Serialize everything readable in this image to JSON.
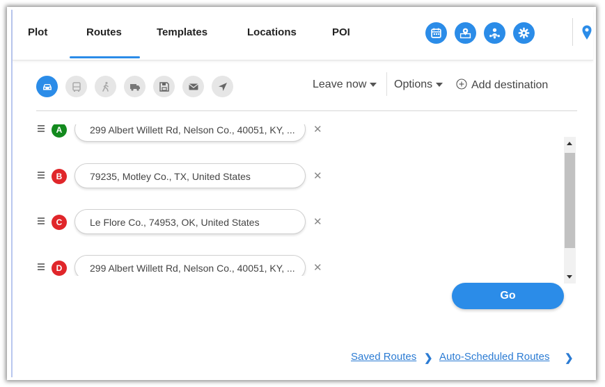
{
  "tabs": [
    {
      "label": "Plot",
      "active": false
    },
    {
      "label": "Routes",
      "active": true
    },
    {
      "label": "Templates",
      "active": false
    },
    {
      "label": "Locations",
      "active": false
    },
    {
      "label": "POI",
      "active": false
    }
  ],
  "header_icons": [
    "calendar-icon",
    "map-pin-icon",
    "network-icon",
    "settings-icon",
    "location-pin-icon"
  ],
  "modes": [
    "car-icon",
    "bus-icon",
    "walk-icon",
    "truck-icon",
    "save-icon",
    "mail-icon",
    "navigation-icon"
  ],
  "toolbar": {
    "leave_now": "Leave now",
    "options": "Options",
    "add_destination": "Add destination"
  },
  "stops": [
    {
      "letter": "A",
      "color": "#138a1e",
      "address": "299 Albert Willett Rd, Nelson Co., 40051, KY, ..."
    },
    {
      "letter": "B",
      "color": "#e0262a",
      "address": "79235, Motley Co., TX, United States"
    },
    {
      "letter": "C",
      "color": "#e0262a",
      "address": "Le Flore Co., 74953, OK, United States"
    },
    {
      "letter": "D",
      "color": "#e0262a",
      "address": "299 Albert Willett Rd, Nelson Co., 40051, KY, ..."
    }
  ],
  "go_label": "Go",
  "links": {
    "saved_routes": "Saved Routes",
    "auto_scheduled": "Auto-Scheduled Routes"
  },
  "colors": {
    "accent": "#2b8ce8",
    "link": "#2b7bd3"
  }
}
